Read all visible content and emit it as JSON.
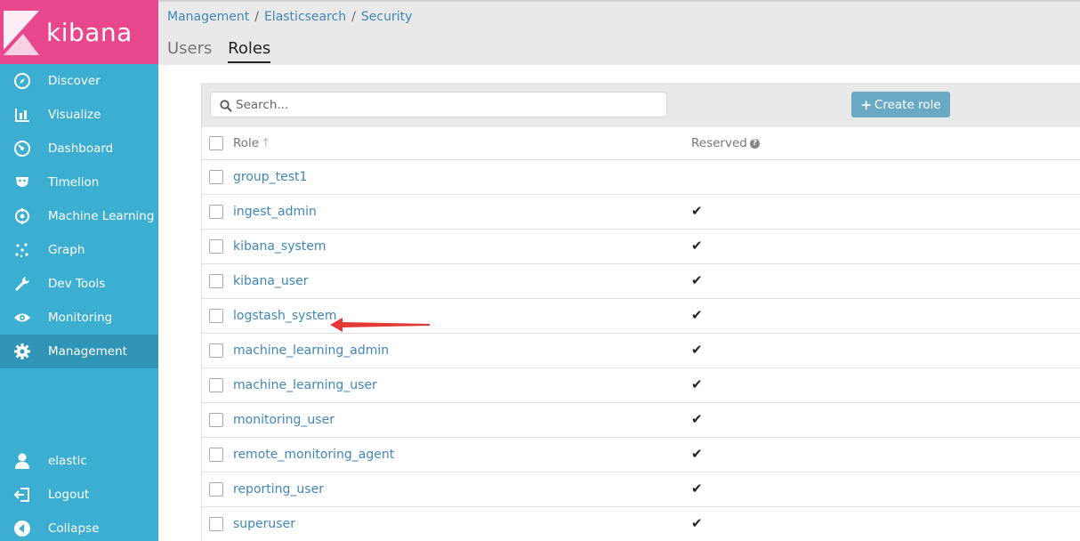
{
  "brand": {
    "name": "kibana",
    "color": "#e8488b"
  },
  "sidebar": {
    "items": [
      {
        "label": "Discover",
        "icon": "compass-icon"
      },
      {
        "label": "Visualize",
        "icon": "bar-chart-icon"
      },
      {
        "label": "Dashboard",
        "icon": "dashboard-icon"
      },
      {
        "label": "Timelion",
        "icon": "timelion-icon"
      },
      {
        "label": "Machine Learning",
        "icon": "machine-learning-icon"
      },
      {
        "label": "Graph",
        "icon": "graph-icon"
      },
      {
        "label": "Dev Tools",
        "icon": "wrench-icon"
      },
      {
        "label": "Monitoring",
        "icon": "eye-icon"
      },
      {
        "label": "Management",
        "icon": "gear-icon",
        "active": true
      }
    ],
    "bottom": [
      {
        "label": "elastic",
        "icon": "user-icon"
      },
      {
        "label": "Logout",
        "icon": "logout-icon"
      },
      {
        "label": "Collapse",
        "icon": "collapse-icon"
      }
    ]
  },
  "breadcrumb": [
    "Management",
    "Elasticsearch",
    "Security"
  ],
  "tabs": [
    {
      "label": "Users",
      "selected": false
    },
    {
      "label": "Roles",
      "selected": true
    }
  ],
  "search": {
    "placeholder": "Search...",
    "value": ""
  },
  "toolbar": {
    "create_label": "Create role"
  },
  "table": {
    "headers": {
      "role": "Role",
      "reserved": "Reserved"
    },
    "rows": [
      {
        "name": "group_test1",
        "reserved": false
      },
      {
        "name": "ingest_admin",
        "reserved": true
      },
      {
        "name": "kibana_system",
        "reserved": true
      },
      {
        "name": "kibana_user",
        "reserved": true
      },
      {
        "name": "logstash_system",
        "reserved": true
      },
      {
        "name": "machine_learning_admin",
        "reserved": true
      },
      {
        "name": "machine_learning_user",
        "reserved": true
      },
      {
        "name": "monitoring_user",
        "reserved": true
      },
      {
        "name": "remote_monitoring_agent",
        "reserved": true
      },
      {
        "name": "reporting_user",
        "reserved": true
      },
      {
        "name": "superuser",
        "reserved": true
      }
    ]
  },
  "colors": {
    "sidebar": "#3caed2",
    "sidebar_active": "#2f94b5",
    "link": "#3f86b6",
    "button": "#6aa9c4",
    "annotation_arrow": "#e53935"
  }
}
